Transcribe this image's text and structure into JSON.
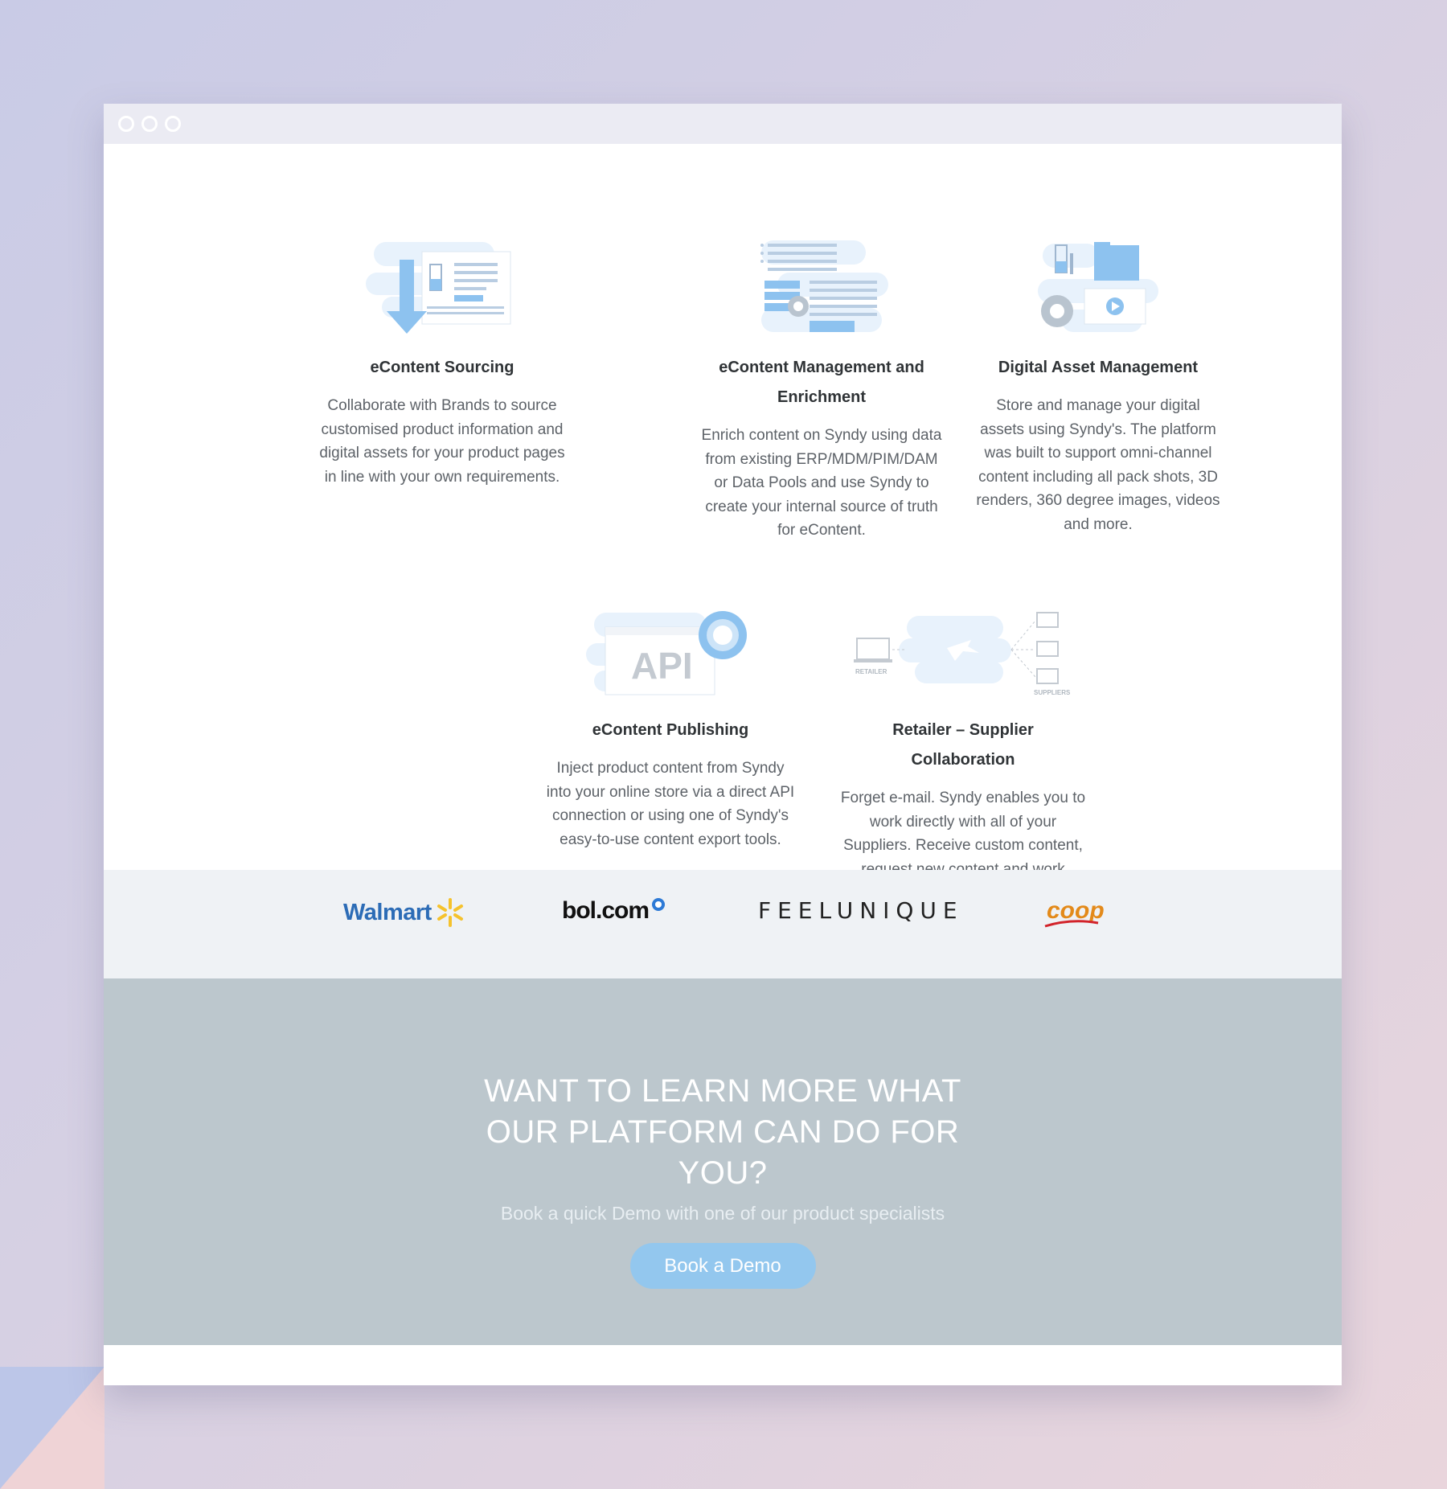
{
  "features": [
    {
      "id": "sourcing",
      "title": "eContent Sourcing",
      "desc": "Collaborate with Brands to source customised product information and digital assets for your product pages in line with your own requirements."
    },
    {
      "id": "management",
      "title": "eContent Management and Enrichment",
      "desc": "Enrich content on Syndy using data from existing ERP/MDM/PIM/DAM or Data Pools and use Syndy to create your internal source of truth for eContent."
    },
    {
      "id": "dam",
      "title": "Digital Asset Management",
      "desc": "Store and manage your digital assets using Syndy's. The platform was built to support omni-channel content including all pack shots, 3D renders, 360 degree images, videos and more."
    },
    {
      "id": "publishing",
      "title": "eContent Publishing",
      "desc": "Inject product content from Syndy into your online store via a direct API connection or using one of Syndy's easy-to-use content export tools."
    },
    {
      "id": "collab",
      "title": "Retailer – Supplier Collaboration",
      "desc": "Forget e-mail. Syndy enables you to work directly with all of your Suppliers. Receive custom content, request new content and work together to drive your online sales."
    }
  ],
  "icons": {
    "api_label": "API",
    "retailer_label": "RETAILER",
    "suppliers_label": "SUPPLIERS"
  },
  "logos": {
    "walmart": "Walmart",
    "bol": "bol.com",
    "feelunique": "FEELUNIQUE",
    "coop": "coop"
  },
  "cta": {
    "heading": "WANT TO LEARN MORE WHAT OUR PLATFORM CAN DO FOR YOU?",
    "subheading": "Book a quick Demo with one of our product specialists",
    "button": "Book a Demo"
  },
  "colors": {
    "accent": "#93c7ee",
    "icon_blue": "#8dc2ef",
    "cta_bg": "#bcc7cd",
    "logos_bg": "#eff2f5"
  }
}
